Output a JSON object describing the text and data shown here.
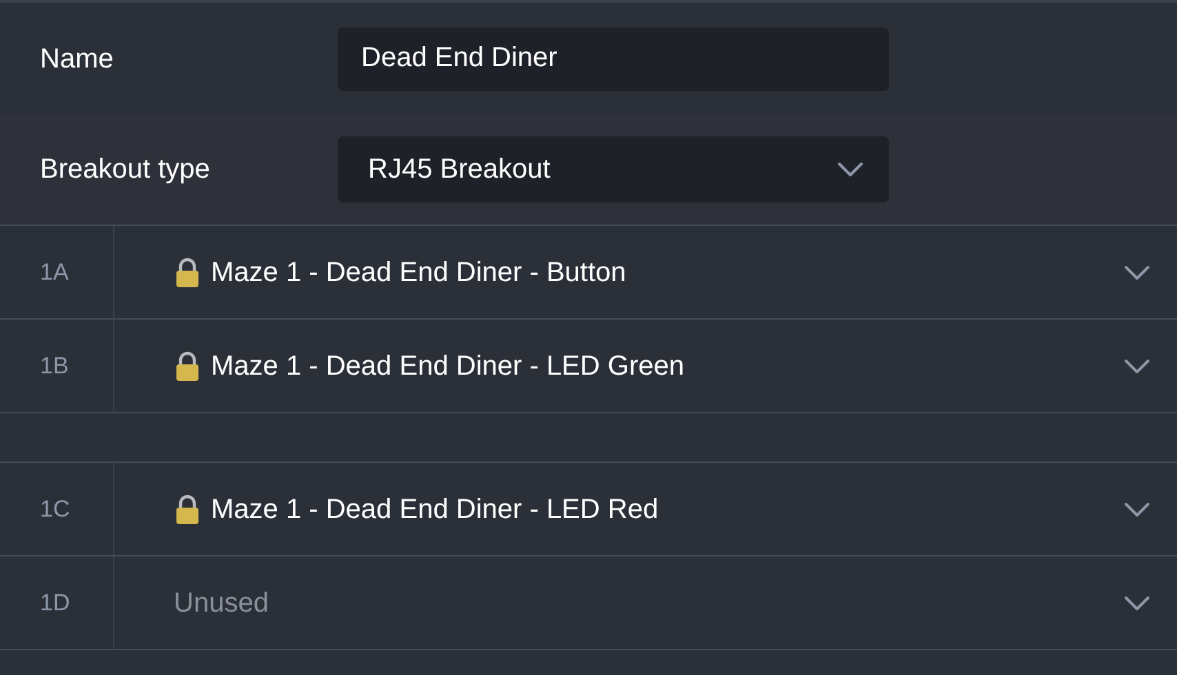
{
  "fields": [
    {
      "kind": "text",
      "label": "Name",
      "value": "Dead End Diner"
    },
    {
      "kind": "select",
      "label": "Breakout type",
      "value": "RJ45 Breakout"
    }
  ],
  "port_groups": [
    {
      "ports": [
        {
          "id": "1A",
          "assigned": true,
          "value": "Maze 1 - Dead End Diner - Button"
        },
        {
          "id": "1B",
          "assigned": true,
          "value": "Maze 1 - Dead End Diner - LED Green"
        }
      ]
    },
    {
      "ports": [
        {
          "id": "1C",
          "assigned": true,
          "value": "Maze 1 - Dead End Diner - LED Red"
        },
        {
          "id": "1D",
          "assigned": false,
          "value": "Unused"
        }
      ]
    }
  ]
}
